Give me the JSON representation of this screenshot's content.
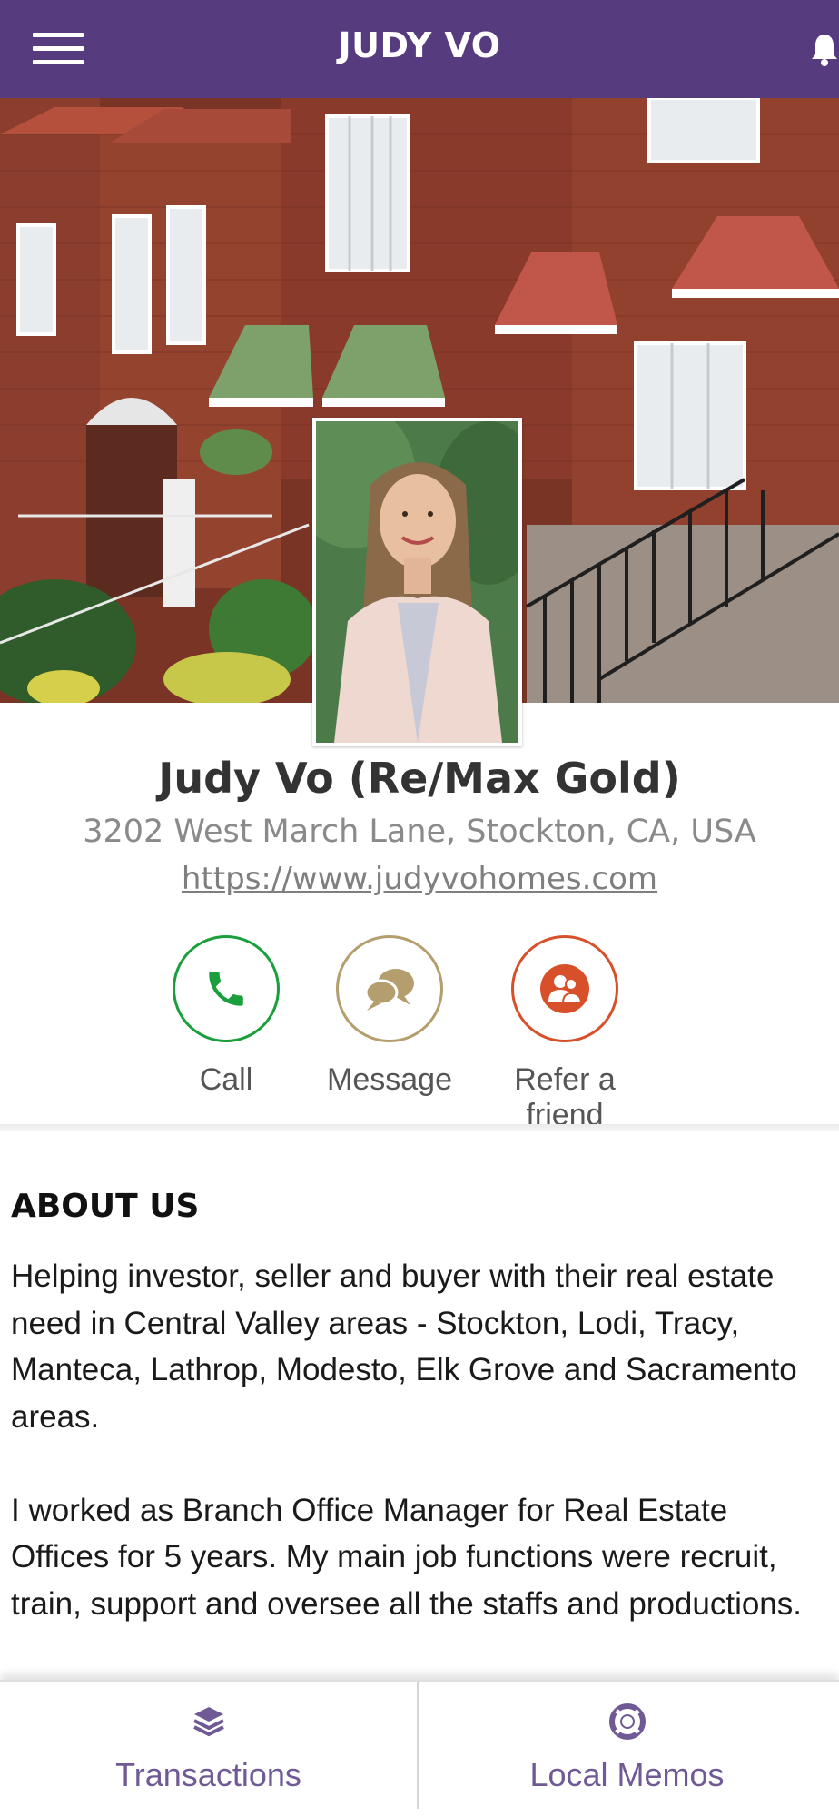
{
  "header": {
    "title": "JUDY VO",
    "menu_icon": "hamburger-menu-icon",
    "notification_icon": "bell-icon",
    "background_color": "#573b7f"
  },
  "profile": {
    "name": "Judy Vo (Re/Max Gold)",
    "address": "3202 West March Lane, Stockton, CA, USA",
    "website": "https://www.judyvohomes.com"
  },
  "actions": [
    {
      "label": "Call",
      "icon": "phone-icon",
      "color": "#1a9f3c"
    },
    {
      "label": "Message",
      "icon": "chat-bubbles-icon",
      "color": "#b59e6e"
    },
    {
      "label": "Refer a friend",
      "icon": "refer-people-icon",
      "color": "#d8502a"
    }
  ],
  "about": {
    "title": "ABOUT US",
    "paragraphs": [
      "Helping investor, seller and buyer with their real estate need in Central Valley areas - Stockton, Lodi, Tracy, Manteca, Lathrop, Modesto, Elk Grove and Sacramento areas.",
      "I worked as Branch Office Manager for Real Estate Offices for 5 years. My main job functions were recruit, train, support and oversee all the staffs and productions."
    ]
  },
  "bottom_nav": {
    "tabs": [
      {
        "label": "Transactions",
        "icon": "layers-icon"
      },
      {
        "label": "Local Memos",
        "icon": "lifebuoy-icon"
      }
    ],
    "accent_color": "#6f5a95"
  }
}
